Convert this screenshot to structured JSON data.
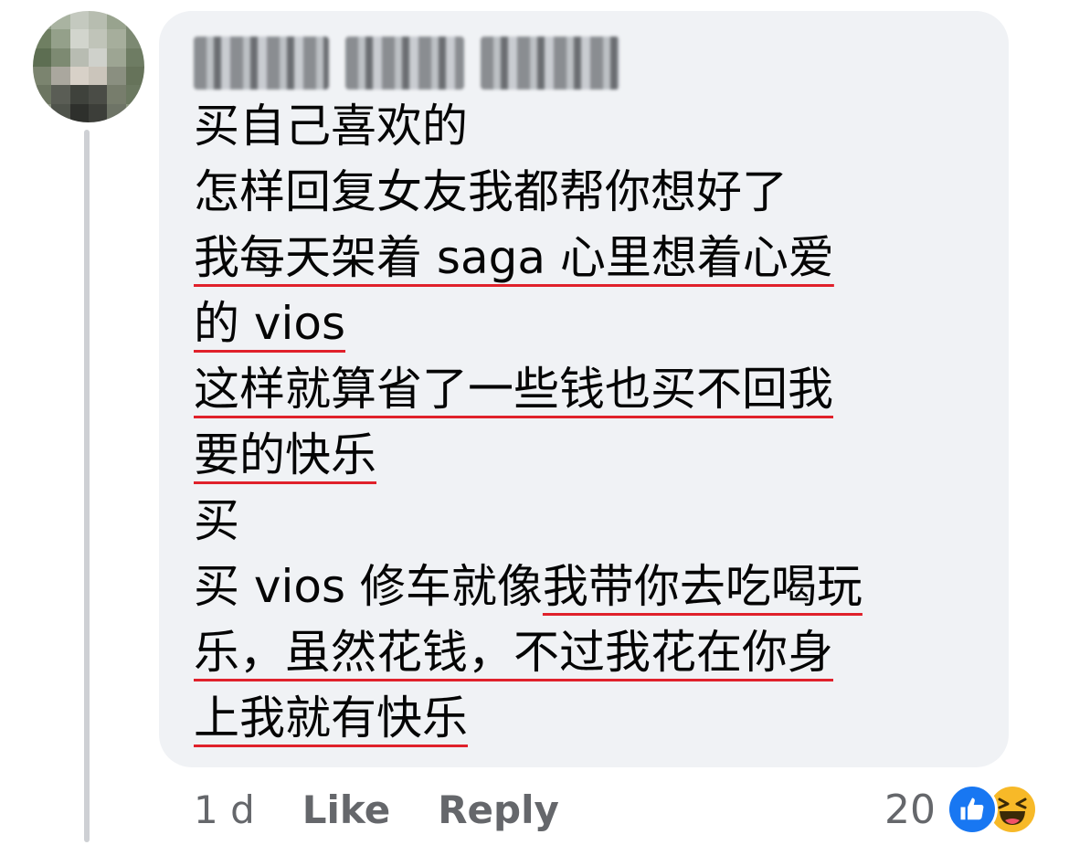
{
  "comment": {
    "author_name": "Kelvin Chun Keong",
    "lines": [
      {
        "text": "买自己喜欢的",
        "underlined": false
      },
      {
        "text": "怎样回复女友我都帮你想好了",
        "underlined": false
      },
      {
        "text": "我每天架着 saga 心里想着心爱",
        "underlined": true
      },
      {
        "text": "的 vios",
        "underlined": true
      },
      {
        "text": "这样就算省了一些钱也买不回我",
        "underlined": true
      },
      {
        "text": "要的快乐",
        "underlined": true
      },
      {
        "text": "买",
        "underlined": false
      },
      {
        "text_plain": "买 vios 修车就像",
        "text_underlined": "我带你去吃喝玩",
        "mixed": true
      },
      {
        "text": "乐，虽然花钱，不过我花在你身",
        "underlined": true
      },
      {
        "text": "上我就有快乐",
        "underlined": true
      }
    ]
  },
  "meta": {
    "time": "1 d",
    "like_label": "Like",
    "reply_label": "Reply"
  },
  "reactions": {
    "count": "20",
    "icons": [
      "like-icon",
      "haha-icon"
    ]
  },
  "colors": {
    "bubble": "#f0f2f5",
    "meta_text": "#65676b",
    "underline": "#e0212b",
    "like_blue": "#1877f2",
    "haha_yellow": "#f7b928"
  }
}
